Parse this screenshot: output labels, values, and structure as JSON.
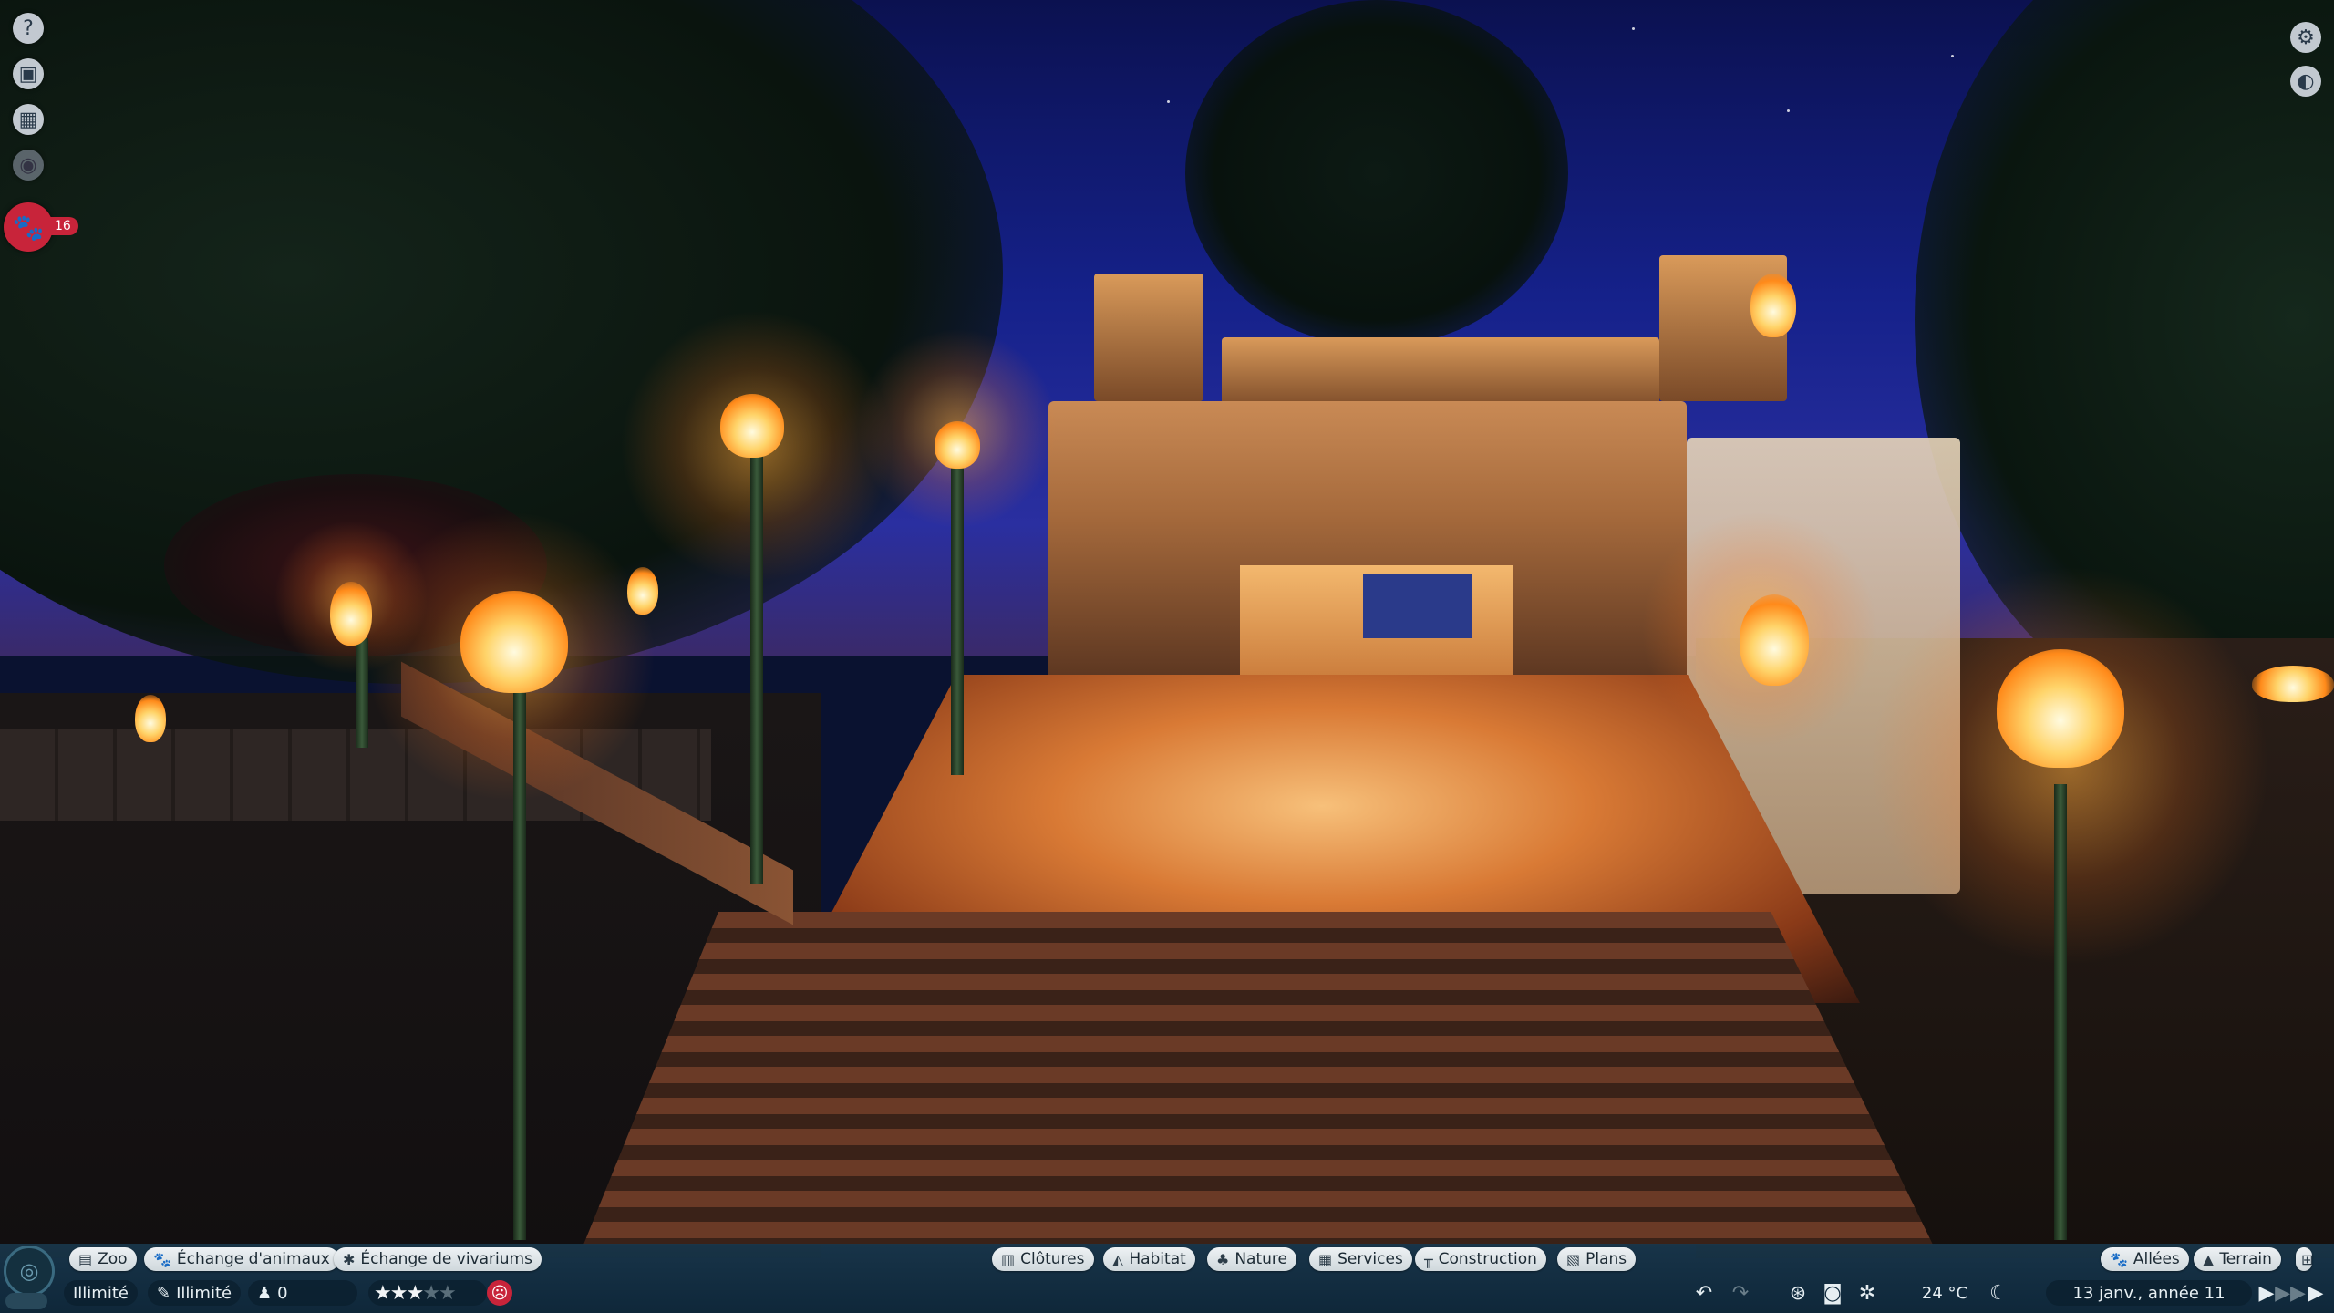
{
  "left_toolbar": [
    {
      "icon": "help-icon",
      "glyph": "?"
    },
    {
      "icon": "guest-card-icon",
      "glyph": "▣"
    },
    {
      "icon": "calendar-icon",
      "glyph": "▦"
    },
    {
      "icon": "view-eye-icon",
      "glyph": "◉"
    }
  ],
  "animals_button": {
    "icon": "paw-icon",
    "glyph": "🐾",
    "count": "16"
  },
  "right_toolbar": [
    {
      "icon": "settings-gear-icon",
      "glyph": "⚙"
    },
    {
      "icon": "camera-view-icon",
      "glyph": "◐"
    }
  ],
  "bottom_left_tabs": [
    {
      "label": "Zoo",
      "icon": "zoo-icon",
      "glyph": "▤"
    },
    {
      "label": "Échange d'animaux",
      "icon": "animal-exchange-icon",
      "glyph": "🐾"
    },
    {
      "label": "Échange de vivariums",
      "icon": "vivarium-exchange-icon",
      "glyph": "✱"
    }
  ],
  "bottom_center_tabs": [
    {
      "label": "Clôtures",
      "icon": "fence-icon",
      "glyph": "▥"
    },
    {
      "label": "Habitat",
      "icon": "habitat-icon",
      "glyph": "◭"
    },
    {
      "label": "Nature",
      "icon": "tree-icon",
      "glyph": "♣"
    },
    {
      "label": "Services",
      "icon": "shop-icon",
      "glyph": "▦"
    },
    {
      "label": "Construction",
      "icon": "construction-icon",
      "glyph": "╥"
    },
    {
      "label": "Plans",
      "icon": "blueprint-icon",
      "glyph": "▧"
    }
  ],
  "bottom_right_tabs": [
    {
      "label": "Allées",
      "icon": "path-icon",
      "glyph": "🐾"
    },
    {
      "label": "Terrain",
      "icon": "terrain-icon",
      "glyph": "▲"
    }
  ],
  "status": {
    "money": "Illimité",
    "research": "Illimité",
    "guests": "0",
    "rating_stars": 3,
    "rating_max": 5,
    "temperature": "24 °C",
    "date": "13 janv., année 11"
  },
  "colors": {
    "hud_bg": "#19374b",
    "pill_bg": "#eef2f4",
    "alert_red": "#c8243a"
  }
}
